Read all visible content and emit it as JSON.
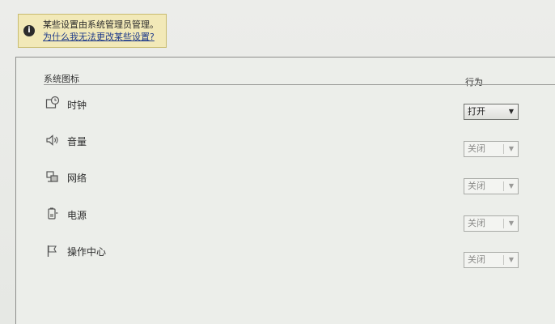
{
  "notice": {
    "text": "某些设置由系统管理员管理。",
    "link": "为什么我无法更改某些设置?",
    "icon": "info-icon"
  },
  "table": {
    "col_icons": "系统图标",
    "col_behavior": "行为"
  },
  "rows": [
    {
      "label": "时钟",
      "icon": "clock-icon",
      "value": "打开",
      "enabled": true
    },
    {
      "label": "音量",
      "icon": "speaker-icon",
      "value": "关闭",
      "enabled": false
    },
    {
      "label": "网络",
      "icon": "network-icon",
      "value": "关闭",
      "enabled": false
    },
    {
      "label": "电源",
      "icon": "power-icon",
      "value": "关闭",
      "enabled": false
    },
    {
      "label": "操作中心",
      "icon": "flag-icon",
      "value": "关闭",
      "enabled": false
    }
  ]
}
